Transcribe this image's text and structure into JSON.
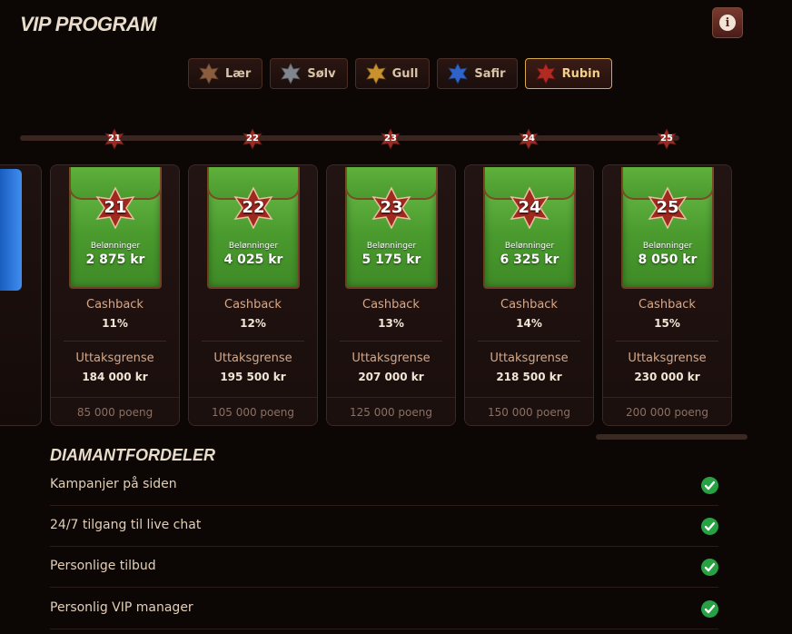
{
  "header": {
    "title": "VIP PROGRAM",
    "info_icon": "info-icon"
  },
  "tabs": [
    {
      "label": "Lær",
      "color": "#9a6b4a",
      "active": false
    },
    {
      "label": "Sølv",
      "color": "#8f969c",
      "active": false
    },
    {
      "label": "Gull",
      "color": "#c9922e",
      "active": false
    },
    {
      "label": "Safir",
      "color": "#2f63c8",
      "active": false
    },
    {
      "label": "Rubin",
      "color": "#b32a22",
      "active": true
    }
  ],
  "levels": [
    {
      "level": "21",
      "reward_label": "Belønninger",
      "reward": "2 875 kr",
      "cashback_label": "Cashback",
      "cashback": "11%",
      "limit_label": "Uttaksgrense",
      "limit": "184 000 kr",
      "points": "85 000 poeng"
    },
    {
      "level": "22",
      "reward_label": "Belønninger",
      "reward": "4 025 kr",
      "cashback_label": "Cashback",
      "cashback": "12%",
      "limit_label": "Uttaksgrense",
      "limit": "195 500 kr",
      "points": "105 000 poeng"
    },
    {
      "level": "23",
      "reward_label": "Belønninger",
      "reward": "5 175 kr",
      "cashback_label": "Cashback",
      "cashback": "13%",
      "limit_label": "Uttaksgrense",
      "limit": "207 000 kr",
      "points": "125 000 poeng"
    },
    {
      "level": "24",
      "reward_label": "Belønninger",
      "reward": "6 325 kr",
      "cashback_label": "Cashback",
      "cashback": "14%",
      "limit_label": "Uttaksgrense",
      "limit": "218 500 kr",
      "points": "150 000 poeng"
    },
    {
      "level": "25",
      "reward_label": "Belønninger",
      "reward": "8 050 kr",
      "cashback_label": "Cashback",
      "cashback": "15%",
      "limit_label": "Uttaksgrense",
      "limit": "230 000 kr",
      "points": "200 000 poeng"
    }
  ],
  "benefits": {
    "title": "DIAMANTFORDELER",
    "items": [
      "Kampanjer på siden",
      "24/7 tilgang til live chat",
      "Personlige tilbud",
      "Personlig VIP manager"
    ],
    "check_color": "#27a243"
  },
  "colors": {
    "accent": "#d9a84a",
    "ruby": "#b32a22",
    "envelope_green": "#4a9a2e"
  }
}
